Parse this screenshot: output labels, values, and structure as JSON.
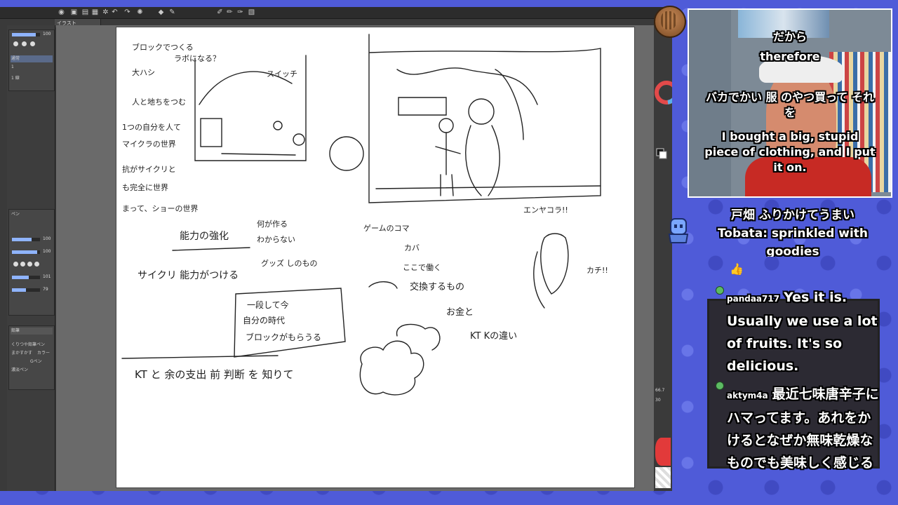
{
  "app": {
    "document_tab": "イラスト",
    "toolbar_icons": [
      "eye-icon",
      "folder-icon",
      "save-icon",
      "grid-icon",
      "settings-icon",
      "undo-icon",
      "redo-icon",
      "loading-icon",
      "transform-icon",
      "pen-icon",
      "pencil-icon",
      "brush-icon",
      "eraser-icon",
      "fill-icon"
    ],
    "left_panel": {
      "brush_size_top": "100",
      "layer_mode": "通常",
      "layer_name": "1",
      "layer_sub": "1 線",
      "brush_group": "ペン",
      "brush_rows": [
        "100",
        "100",
        "101",
        "79"
      ],
      "brush_list_title": "鉛筆",
      "brush_items": [
        "くりつや鉛筆ペン",
        "まかすかす",
        "Gペン",
        "濃淡ペン"
      ],
      "color_label": "カラー"
    },
    "right_panel": {
      "zoom": "66.7",
      "rotation": "30"
    }
  },
  "canvas": {
    "notes": [
      "ブロックでつくる",
      "ラボになる？",
      "スイッチ",
      "大ハシ",
      "人と地ちをつむ",
      "1つの自分を人て",
      "マイクラの世界",
      "抗がサイクリと",
      "も完全に世界",
      "まって、ショーの世界",
      "能力の強化",
      "サイクリ 能力がつける",
      "何が作る",
      "わからない",
      "グッズ しのもの",
      "ゲームのコマ",
      "カバ",
      "ここで働く",
      "交換するもの",
      "お金と",
      "KT Kの違い",
      "エンヤコラ!!",
      "カチ!!",
      "一段して今",
      "自分の時代",
      "ブロックがもらうる",
      "KT と 余の支出 前 判断 を 知りて"
    ]
  },
  "stream": {
    "subtitle_jp_1": "だから",
    "subtitle_en_1": "therefore",
    "subtitle_jp_2": "バカでかい 服 のやつ買って それを",
    "subtitle_en_2": "I bought a big, stupid piece of clothing, and I put it on.",
    "caption_jp": "戸畑 ふりかけてうまい",
    "caption_en": "Tobata: sprinkled with goodies"
  },
  "chat": {
    "emoji": "👍",
    "messages": [
      {
        "user": "pandaa717",
        "text": "Yes it is. Usually we use a lot of fruits. It's so delicious."
      },
      {
        "user": "aktym4a",
        "text": "最近七味唐辛子にハマってます。あれをかけるとなぜか無味乾燥なものでも美味しく感じる"
      }
    ]
  },
  "colors": {
    "background": "#4f5bd8",
    "app_bg": "#3a3a3a",
    "canvas": "#ffffff",
    "chat_user_badge": "#5dbb63"
  }
}
